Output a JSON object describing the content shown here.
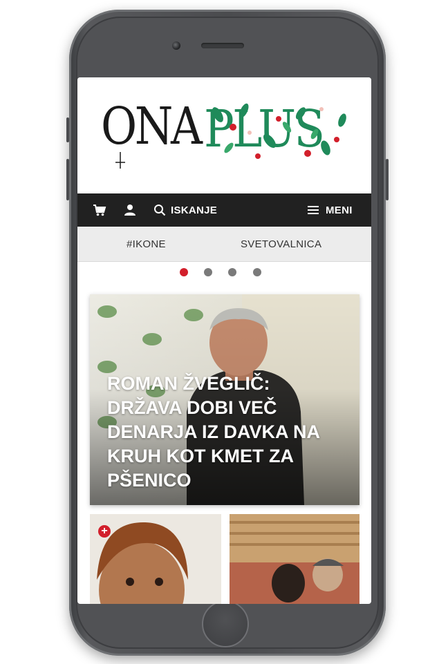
{
  "brand": {
    "logo_part1": "ONA",
    "logo_part2": "PLUS"
  },
  "navbar": {
    "cart_icon": "cart-icon",
    "user_icon": "user-icon",
    "search_label": "ISKANJE",
    "menu_label": "MENI"
  },
  "categories": [
    "#IKONE",
    "SVETOVALNICA"
  ],
  "carousel": {
    "slide_count": 4,
    "active_index": 0
  },
  "hero": {
    "title": "ROMAN ŽVEGLIČ: DRŽAVA DOBI VEČ DENARJA IZ DAVKA NA KRUH KOT KMET ZA PŠENICO"
  },
  "cards": [
    {
      "badge": "+"
    },
    {
      "badge": ""
    }
  ],
  "colors": {
    "accent": "#d21f2b",
    "navbar": "#212121",
    "logo_green": "#1f8a5a"
  }
}
